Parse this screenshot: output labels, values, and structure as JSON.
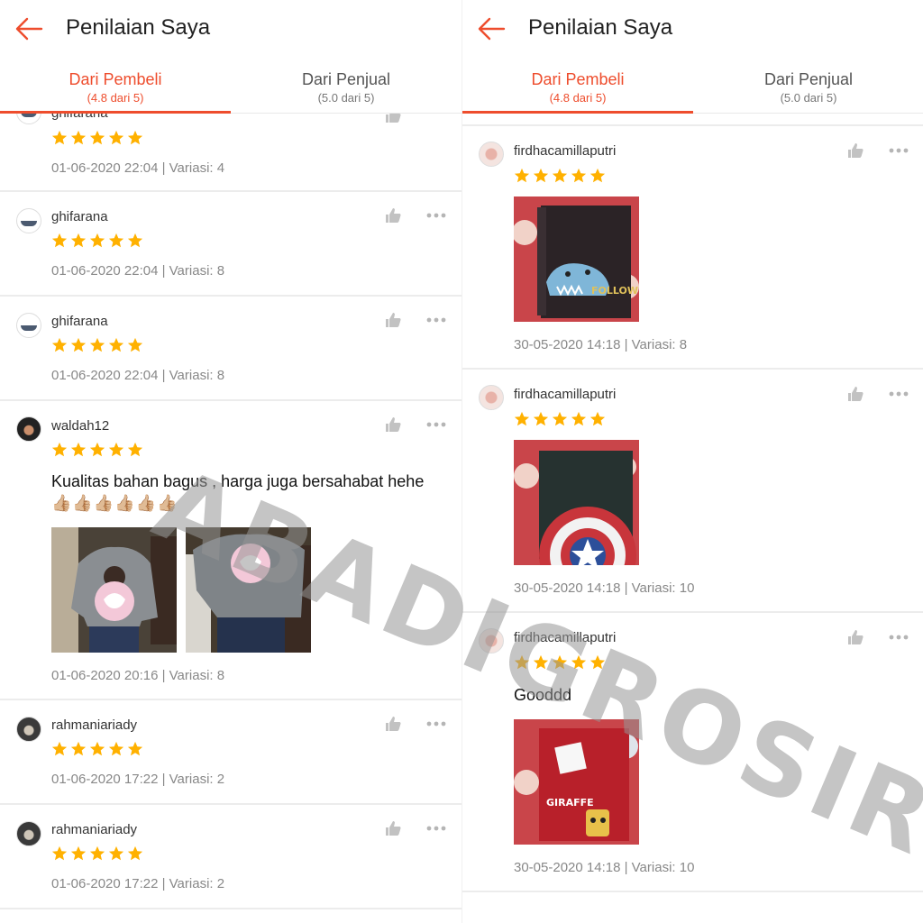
{
  "header": {
    "title": "Penilaian Saya"
  },
  "tabs": [
    {
      "label": "Dari Pembeli",
      "sub": "(4.8 dari 5)"
    },
    {
      "label": "Dari Penjual",
      "sub": "(5.0 dari 5)"
    }
  ],
  "left_reviews": [
    {
      "username": "ghifarana",
      "rating": 5,
      "meta": "01-06-2020 22:04 | Variasi: 4"
    },
    {
      "username": "ghifarana",
      "rating": 5,
      "meta": "01-06-2020 22:04 | Variasi: 8"
    },
    {
      "username": "ghifarana",
      "rating": 5,
      "meta": "01-06-2020 22:04 | Variasi: 8"
    },
    {
      "username": "waldah12",
      "rating": 5,
      "comment": "Kualitas bahan bagus , harga juga bersahabat hehe",
      "emojis": "👍🏼👍🏼👍🏼👍🏼👍🏼👍🏼",
      "meta": "01-06-2020 20:16 | Variasi: 8"
    },
    {
      "username": "rahmaniariady",
      "rating": 5,
      "meta": "01-06-2020 17:22 | Variasi: 2"
    },
    {
      "username": "rahmaniariady",
      "rating": 5,
      "meta": "01-06-2020 17:22 | Variasi: 2"
    }
  ],
  "right_reviews": [
    {
      "username": "firdhacamillaputri",
      "rating": 5,
      "meta": "30-05-2020 14:18 | Variasi: 8"
    },
    {
      "username": "firdhacamillaputri",
      "rating": 5,
      "meta": "30-05-2020 14:18 | Variasi: 10"
    },
    {
      "username": "firdhacamillaputri",
      "rating": 5,
      "comment": "Gooddd",
      "meta": "30-05-2020 14:18 | Variasi: 10"
    }
  ],
  "photo_texts": {
    "dino": "FOLLOW ME",
    "giraffe": "GIRAFFE"
  },
  "watermark": "ABADIGROSIR",
  "colors": {
    "accent": "#ee4d2d",
    "star": "#ffb100",
    "divider": "#ececec"
  },
  "icons": [
    "back-arrow-icon",
    "thumbs-up-icon",
    "more-dots-icon",
    "star-icon"
  ]
}
